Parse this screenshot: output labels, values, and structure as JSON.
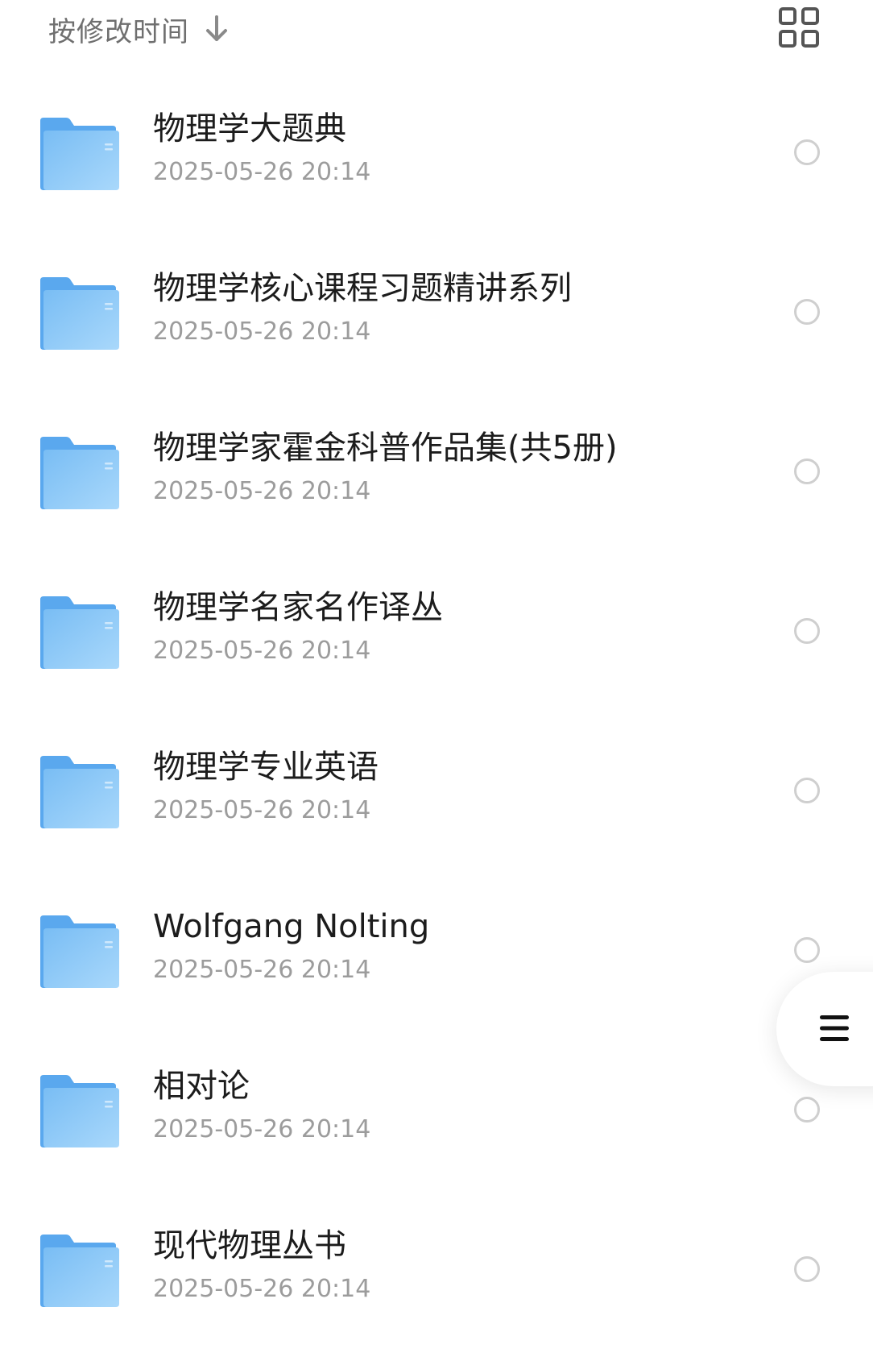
{
  "toolbar": {
    "sort_label": "按修改时间",
    "sort_direction_icon": "arrow-down-icon",
    "view_toggle_icon": "grid-view-icon"
  },
  "colors": {
    "folder_back": "#5aa8ee",
    "folder_front_top": "#79bdf4",
    "folder_front_bottom": "#a9d8fb",
    "radio_border": "#cfcfcf",
    "name_text": "#1c1c1c",
    "date_text": "#9c9c9c"
  },
  "items": [
    {
      "name": "物理学大题典",
      "date": "2025-05-26 20:14",
      "icon": "folder-icon"
    },
    {
      "name": "物理学核心课程习题精讲系列",
      "date": "2025-05-26 20:14",
      "icon": "folder-icon"
    },
    {
      "name": "物理学家霍金科普作品集(共5册)",
      "date": "2025-05-26 20:14",
      "icon": "folder-icon"
    },
    {
      "name": "物理学名家名作译丛",
      "date": "2025-05-26 20:14",
      "icon": "folder-icon"
    },
    {
      "name": "物理学专业英语",
      "date": "2025-05-26 20:14",
      "icon": "folder-icon"
    },
    {
      "name": "Wolfgang Nolting",
      "date": "2025-05-26 20:14",
      "icon": "folder-icon"
    },
    {
      "name": "相对论",
      "date": "2025-05-26 20:14",
      "icon": "folder-icon"
    },
    {
      "name": "现代物理丛书",
      "date": "2025-05-26 20:14",
      "icon": "folder-icon"
    }
  ],
  "floating_menu": {
    "icon": "menu-icon"
  }
}
